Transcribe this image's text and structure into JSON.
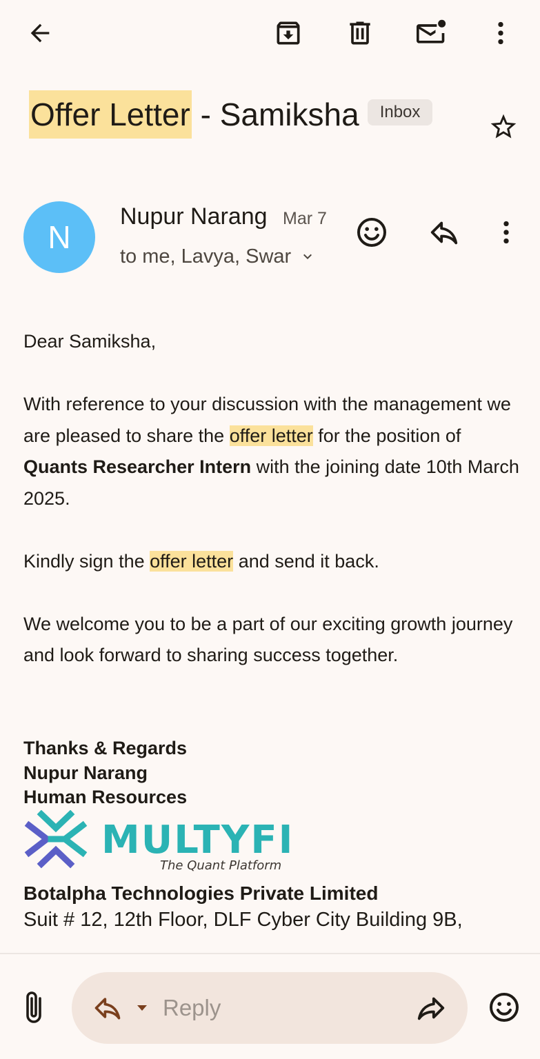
{
  "subject": {
    "highlighted": "Offer Letter",
    "rest": " - Samiksha",
    "label": "Inbox"
  },
  "sender": {
    "initial": "N",
    "name": "Nupur Narang",
    "date": "Mar 7",
    "recipients": "to me, Lavya, Swar"
  },
  "body": {
    "greeting": "Dear Samiksha,",
    "p1_a": "With reference to your discussion with the management we are pleased to share the ",
    "p1_hl": "offer letter",
    "p1_b": " for the position of ",
    "p1_bold": "Quants Researcher Intern",
    "p1_c": " with the joining date 10th March 2025.",
    "p2_a": "Kindly sign the ",
    "p2_hl": "offer letter",
    "p2_b": " and send it back.",
    "p3": "We welcome you to be a part of our exciting growth journey and look forward to sharing success together."
  },
  "signature": {
    "line1": "Thanks & Regards",
    "line2": "Nupur Narang",
    "line3": "Human Resources",
    "logo_text": "MULTYFI",
    "logo_tagline": "The Quant Platform",
    "company": "Botalpha Technologies Private Limited",
    "address": "Suit # 12, 12th Floor, DLF Cyber City Building 9B,"
  },
  "reply_bar": {
    "placeholder": "Reply"
  },
  "icons": {
    "top_bar": [
      "back-arrow-icon",
      "archive-icon",
      "delete-icon",
      "mark-unread-icon",
      "more-vert-icon"
    ],
    "subject": [
      "star-icon"
    ],
    "message": [
      "emoji-react-icon",
      "reply-icon",
      "more-vert-icon",
      "chevron-down-icon"
    ],
    "bottom": [
      "attach-icon",
      "reply-icon",
      "caret-down-icon",
      "forward-icon",
      "emoji-react-icon"
    ]
  },
  "colors": {
    "background": "#fdf8f5",
    "highlight": "#fbe19b",
    "avatar": "#5cbff7",
    "reply_pill": "#f2e5dd",
    "logo_teal": "#2bb3b4",
    "logo_purple": "#5b5fc7"
  }
}
